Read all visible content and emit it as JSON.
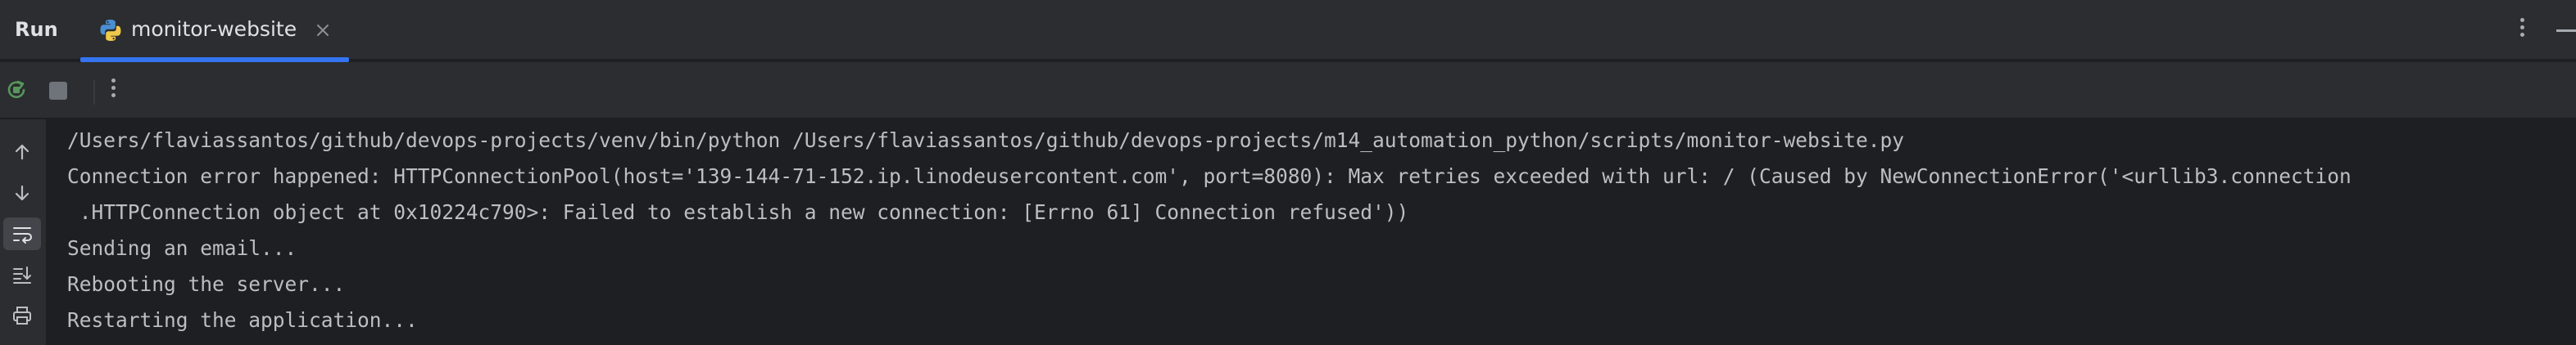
{
  "header": {
    "title": "Run",
    "tab_label": "monitor-website",
    "tab_icon": "python-icon",
    "close_icon": "close-icon",
    "menu_icon": "kebab-menu-icon",
    "minimize_icon": "minimize-icon"
  },
  "toolbar": {
    "rerun_icon": "rerun-icon",
    "stop_icon": "stop-icon",
    "more_icon": "kebab-menu-icon"
  },
  "gutter": {
    "icons": [
      "arrow-up-icon",
      "arrow-down-icon",
      "soft-wrap-icon",
      "scroll-to-end-icon",
      "print-icon"
    ]
  },
  "console": {
    "lines": [
      "/Users/flaviassantos/github/devops-projects/venv/bin/python /Users/flaviassantos/github/devops-projects/m14_automation_python/scripts/monitor-website.py",
      "Connection error happened: HTTPConnectionPool(host='139-144-71-152.ip.linodeusercontent.com', port=8080): Max retries exceeded with url: / (Caused by NewConnectionError('<urllib3.connection",
      " .HTTPConnection object at 0x10224c790>: Failed to establish a new connection: [Errno 61] Connection refused'))",
      "Sending an email...",
      "Rebooting the server...",
      "Restarting the application..."
    ]
  },
  "colors": {
    "background": "#1e1f22",
    "panel": "#2b2d30",
    "accent": "#3574f0",
    "text": "#bcbec4"
  }
}
